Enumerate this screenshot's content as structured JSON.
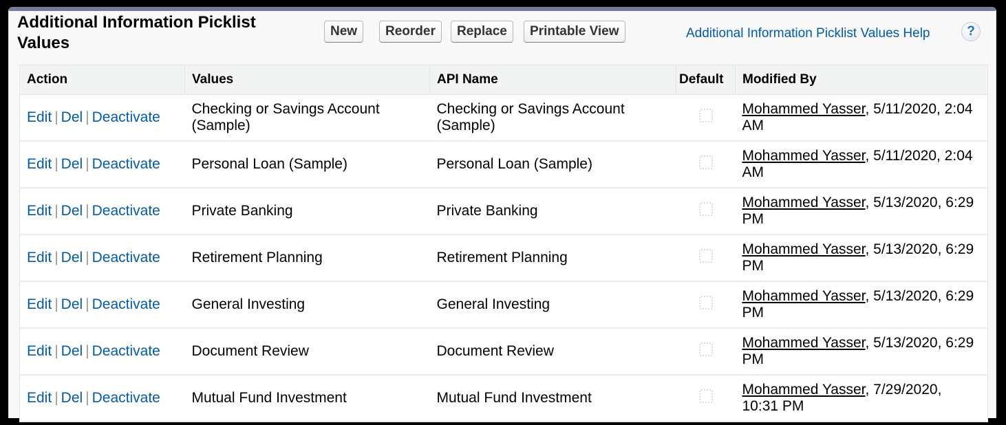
{
  "header": {
    "title": "Additional Information Picklist Values",
    "buttons": {
      "new": "New",
      "reorder": "Reorder",
      "replace": "Replace",
      "printable_view": "Printable View"
    },
    "help_link": "Additional Information Picklist Values Help",
    "help_icon": "?"
  },
  "table": {
    "columns": [
      "Action",
      "Values",
      "API Name",
      "Default",
      "Modified By"
    ],
    "action_labels": {
      "edit": "Edit",
      "del": "Del",
      "deactivate": "Deactivate",
      "separator": "|"
    },
    "rows": [
      {
        "value": "Checking or Savings Account (Sample)",
        "api_name": "Checking or Savings Account (Sample)",
        "default": false,
        "modified_by": "Mohammed Yasser",
        "modified_date": ", 5/11/2020, 2:04 AM"
      },
      {
        "value": "Personal Loan (Sample)",
        "api_name": "Personal Loan (Sample)",
        "default": false,
        "modified_by": "Mohammed Yasser",
        "modified_date": ", 5/11/2020, 2:04 AM"
      },
      {
        "value": "Private Banking",
        "api_name": "Private Banking",
        "default": false,
        "modified_by": "Mohammed Yasser",
        "modified_date": ", 5/13/2020, 6:29 PM"
      },
      {
        "value": "Retirement Planning",
        "api_name": "Retirement Planning",
        "default": false,
        "modified_by": "Mohammed Yasser",
        "modified_date": ", 5/13/2020, 6:29 PM"
      },
      {
        "value": "General Investing",
        "api_name": "General Investing",
        "default": false,
        "modified_by": "Mohammed Yasser",
        "modified_date": ", 5/13/2020, 6:29 PM"
      },
      {
        "value": "Document Review",
        "api_name": "Document Review",
        "default": false,
        "modified_by": "Mohammed Yasser",
        "modified_date": ", 5/13/2020, 6:29 PM"
      },
      {
        "value": "Mutual Fund Investment",
        "api_name": "Mutual Fund Investment",
        "default": false,
        "modified_by": "Mohammed Yasser",
        "modified_date": ", 7/29/2020, 10:31 PM"
      }
    ]
  },
  "colors": {
    "link": "#015ba7",
    "header_bar": "#747e96",
    "table_header_bg": "#f2f3f3"
  }
}
